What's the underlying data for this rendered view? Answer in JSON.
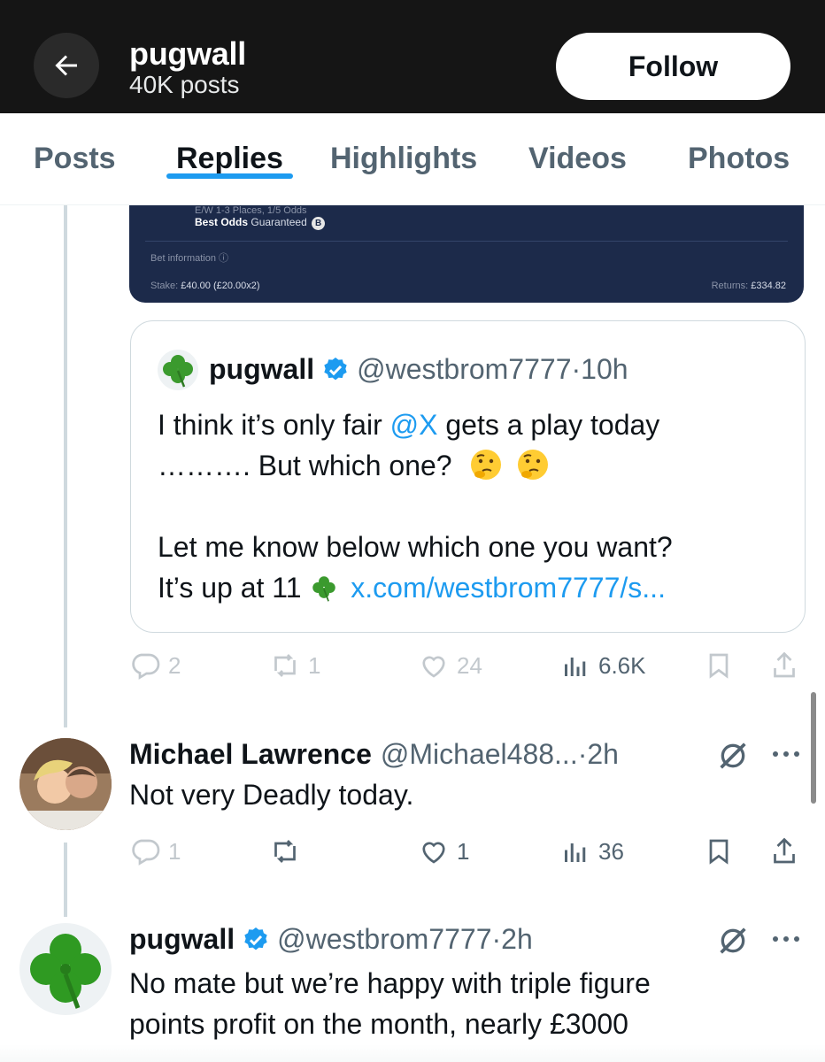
{
  "header": {
    "profile_name": "pugwall",
    "post_count": "40K posts",
    "follow_label": "Follow"
  },
  "tabs": [
    {
      "label": "Posts",
      "active": false
    },
    {
      "label": "Replies",
      "active": true
    },
    {
      "label": "Highlights",
      "active": false
    },
    {
      "label": "Videos",
      "active": false
    },
    {
      "label": "Photos",
      "active": false
    }
  ],
  "bet_slip": {
    "ew_text": "E/W 1-3 Places, 1/5 Odds",
    "best_odds_bold": "Best Odds",
    "best_odds_rest": "Guaranteed",
    "badge": "B",
    "bet_info": "Bet information ⓘ",
    "stake_label": "Stake:",
    "stake_value": "£40.00 (£20.00x2)",
    "returns_label": "Returns:",
    "returns_value": "£334.82"
  },
  "quoted_post": {
    "name": "pugwall",
    "handle": "@westbrom7777",
    "time": "·10h",
    "line1_a": "I think it’s only fair ",
    "line1_mention": "@X",
    "line1_b": " gets a play today",
    "line2": "………. But which one?",
    "line3": "Let me know below which one you want?",
    "line4_a": "It’s up at 11",
    "line4_link": "x.com/westbrom7777/s..."
  },
  "post_actions": {
    "replies": "2",
    "reposts": "1",
    "likes": "24",
    "views": "6.6K"
  },
  "reply1": {
    "name": "Michael Lawrence",
    "handle": "@Michael488...",
    "time": "·2h",
    "text": "Not very Deadly today.",
    "replies": "1",
    "likes": "1",
    "views": "36"
  },
  "reply2": {
    "name": "pugwall",
    "handle": "@westbrom7777",
    "time": "·2h",
    "line1": "No mate but we’re happy with triple figure",
    "line2": "points profit on the month, nearly £3000"
  },
  "colors": {
    "accent": "#1d9bf0",
    "text_primary": "#0f1419",
    "text_secondary": "#536471",
    "header_bg": "#151515"
  }
}
